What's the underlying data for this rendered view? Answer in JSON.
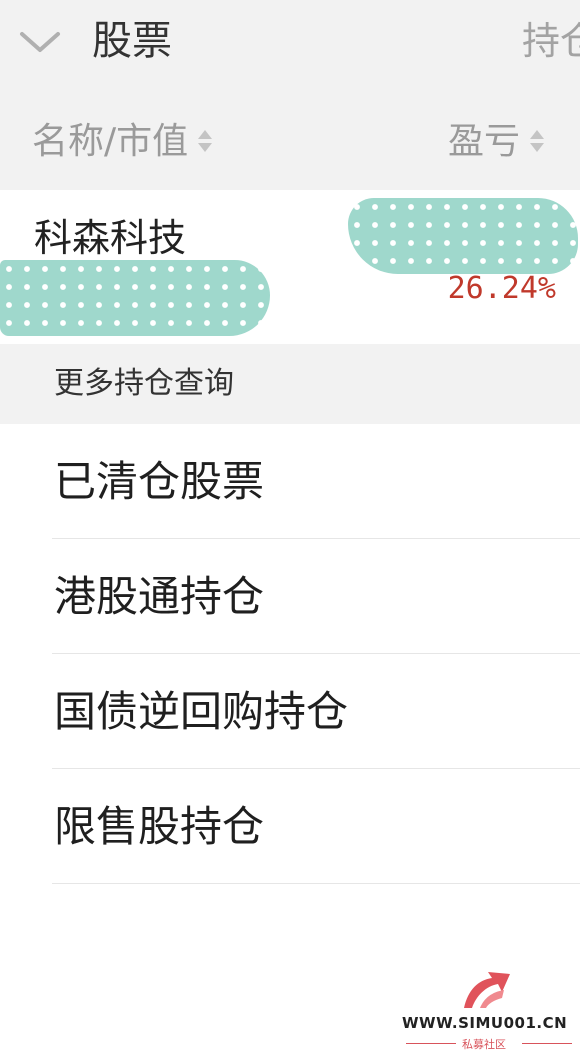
{
  "header": {
    "title": "股票",
    "right_tab": "持仓",
    "collapse_icon": "chevron-down-icon"
  },
  "columns": {
    "left": "名称/市值",
    "right": "盈亏",
    "sort_icon": "sort-updown-icon"
  },
  "holding": {
    "name": "科森科技",
    "pl_percent": "26.24%",
    "pl_color": "#c0392b"
  },
  "more_query": {
    "label": "更多持仓查询"
  },
  "menu": {
    "items": [
      {
        "label": "已清仓股票"
      },
      {
        "label": "港股通持仓"
      },
      {
        "label": "国债逆回购持仓"
      },
      {
        "label": "限售股持仓"
      }
    ]
  },
  "watermark": {
    "site": "WWW.SIMU001.CN",
    "sub": "私募社区"
  }
}
